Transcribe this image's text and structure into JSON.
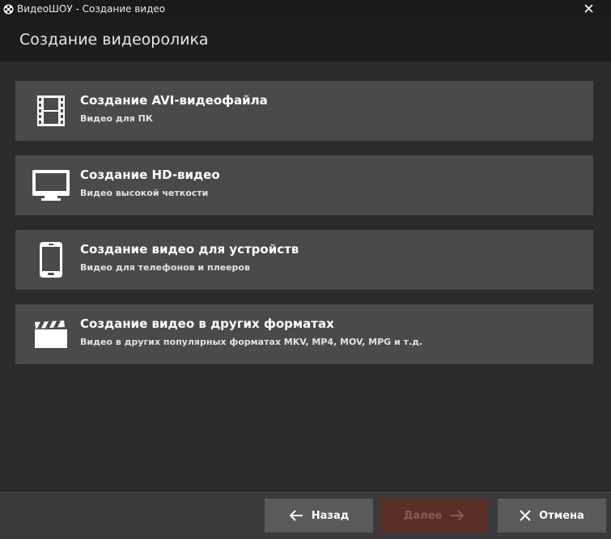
{
  "window": {
    "title": "ВидеоШОУ - Создание видео"
  },
  "header": {
    "title": "Создание видеоролика"
  },
  "options": [
    {
      "icon": "film-strip-icon",
      "title": "Создание AVI-видеофайла",
      "subtitle": "Видео для ПК"
    },
    {
      "icon": "monitor-icon",
      "title": "Создание HD-видео",
      "subtitle": "Видео высокой четкости"
    },
    {
      "icon": "smartphone-icon",
      "title": "Создание видео для устройств",
      "subtitle": "Видео для телефонов и плееров"
    },
    {
      "icon": "clapperboard-icon",
      "title": "Создание видео в других форматах",
      "subtitle": "Видео в других популярных форматах MKV, MP4, MOV, MPG и т.д."
    }
  ],
  "footer": {
    "back_label": "Назад",
    "next_label": "Далее",
    "cancel_label": "Отмена"
  },
  "colors": {
    "background": "#2b2a2c",
    "card": "#4a494b",
    "button": "#5a595b",
    "button_disabled": "#5a2f24"
  }
}
